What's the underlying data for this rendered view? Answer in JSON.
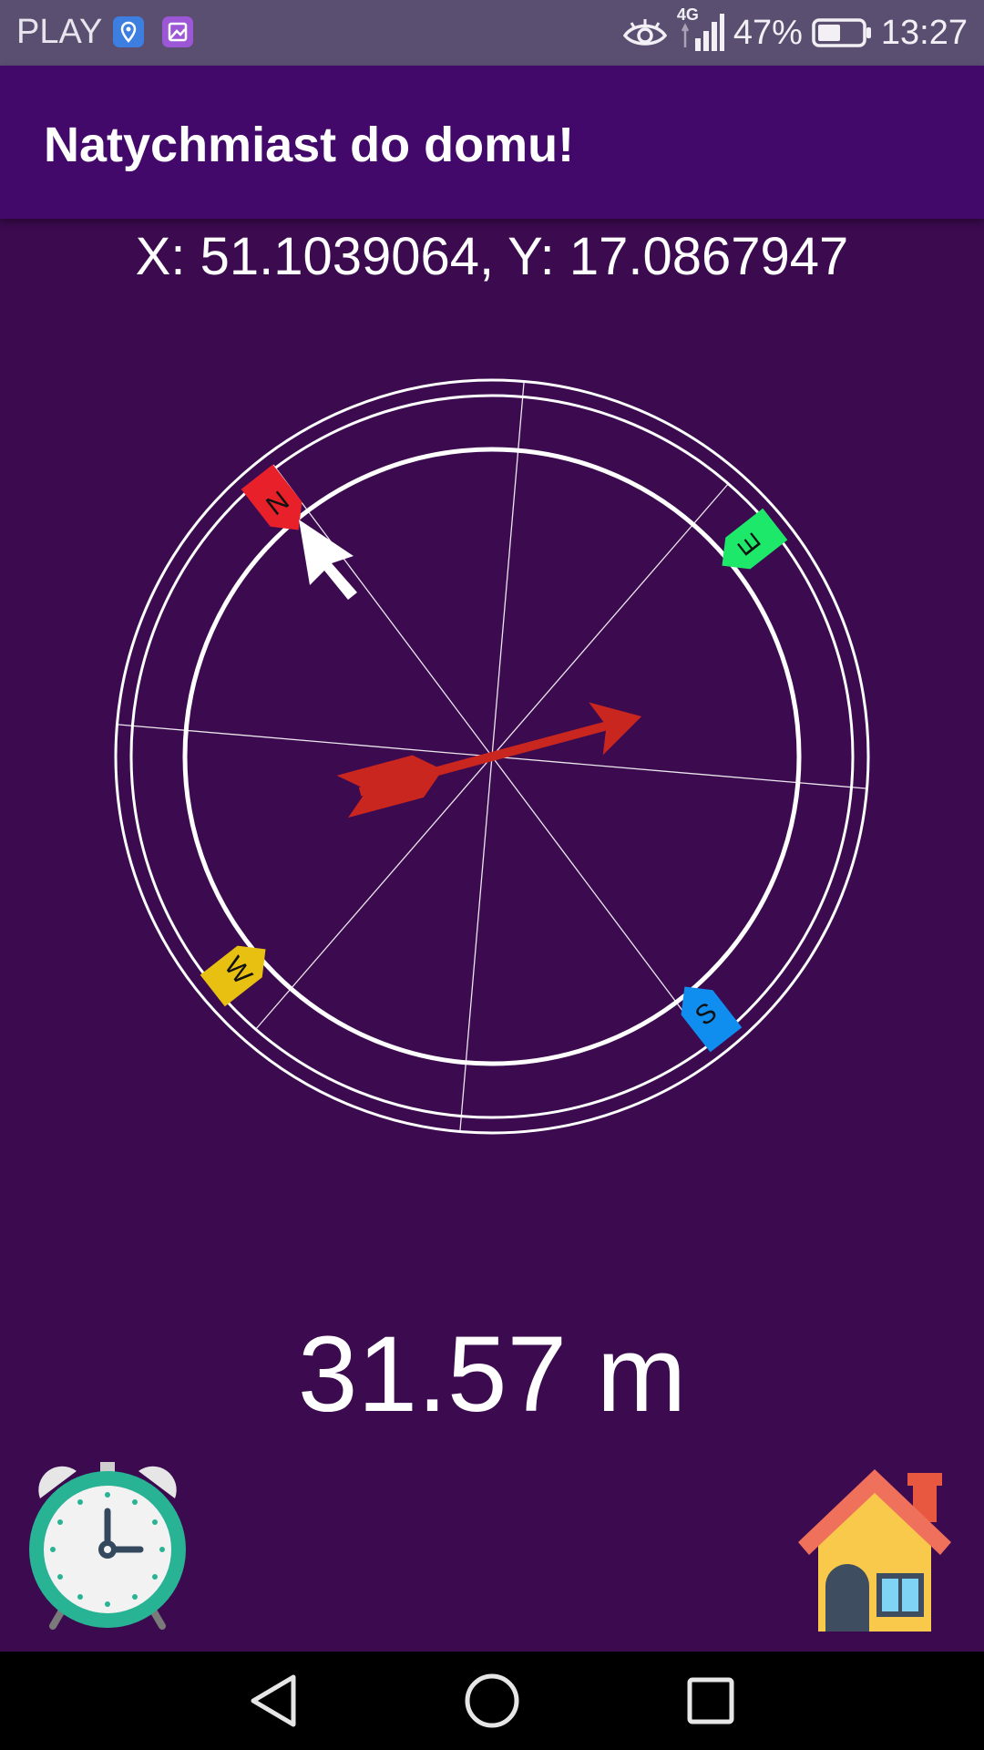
{
  "status_bar": {
    "carrier": "PLAY",
    "network": "4G",
    "battery": "47%",
    "time": "13:27",
    "icons": [
      "location-app-icon",
      "gallery-app-icon",
      "eye-icon",
      "signal-icon",
      "battery-icon"
    ]
  },
  "app_bar": {
    "title": "Natychmiast do domu!"
  },
  "location": {
    "coordinates_text": "X: 51.1039064, Y: 17.0867947"
  },
  "compass": {
    "markers": [
      {
        "label": "N",
        "color": "#e8202a"
      },
      {
        "label": "E",
        "color": "#1ee86a"
      },
      {
        "label": "S",
        "color": "#0f8ef0"
      },
      {
        "label": "W",
        "color": "#e8c012"
      }
    ],
    "needle_icon": "white-pointer-arrow-icon",
    "direction_icon": "red-arrow-icon",
    "direction_color": "#c8261e"
  },
  "distance": {
    "text": "31.57 m"
  },
  "actions": {
    "alarm_icon": "alarm-clock-icon",
    "home_icon": "house-icon"
  },
  "nav_bar": {
    "icons": [
      "back-triangle-icon",
      "home-circle-icon",
      "recents-square-icon"
    ]
  }
}
